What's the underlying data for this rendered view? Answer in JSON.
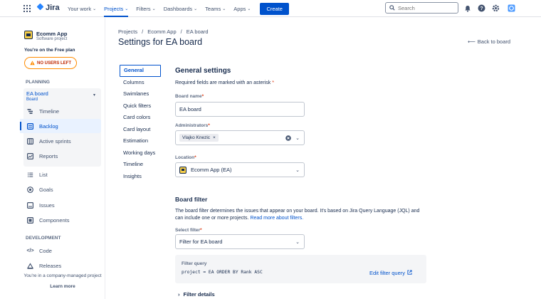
{
  "topbar": {
    "logo": "Jira",
    "nav": [
      {
        "label": "Your work"
      },
      {
        "label": "Projects"
      },
      {
        "label": "Filters"
      },
      {
        "label": "Dashboards"
      },
      {
        "label": "Teams"
      },
      {
        "label": "Apps"
      }
    ],
    "active_nav": "Projects",
    "create_label": "Create",
    "search_placeholder": "Search",
    "icons": [
      "apps-grid-icon",
      "notification-icon",
      "help-icon",
      "settings-icon",
      "profile-icon"
    ]
  },
  "sidebar": {
    "project_name": "Ecomm App",
    "project_type": "Software project",
    "plan_text": "You're on the Free plan",
    "users_badge": "NO USERS LEFT",
    "planning_label": "PLANNING",
    "board_name": "EA board",
    "board_sub": "Board",
    "board_items": [
      {
        "label": "Timeline",
        "icon": "timeline-icon"
      },
      {
        "label": "Backlog",
        "icon": "backlog-icon"
      },
      {
        "label": "Active sprints",
        "icon": "board-icon"
      },
      {
        "label": "Reports",
        "icon": "reports-icon"
      }
    ],
    "selected_item": "Backlog",
    "other_items": [
      {
        "label": "List",
        "icon": "list-icon"
      },
      {
        "label": "Goals",
        "icon": "goals-icon"
      },
      {
        "label": "Issues",
        "icon": "issues-icon"
      },
      {
        "label": "Components",
        "icon": "components-icon"
      }
    ],
    "development_label": "DEVELOPMENT",
    "dev_items": [
      {
        "label": "Code",
        "icon": "code-icon"
      },
      {
        "label": "Releases",
        "icon": "releases-icon"
      }
    ],
    "managed_text": "You're in a company-managed project",
    "learn_more": "Learn more"
  },
  "breadcrumbs": [
    "Projects",
    "/",
    "Ecomm App",
    "/",
    "EA board"
  ],
  "page_title": "Settings for EA board",
  "back_link": "Back to board",
  "settings_nav": [
    "General",
    "Columns",
    "Swimlanes",
    "Quick filters",
    "Card colors",
    "Card layout",
    "Estimation",
    "Working days",
    "Timeline",
    "Insights"
  ],
  "active_settings_nav": "General",
  "general": {
    "heading": "General settings",
    "required_note": "Required fields are marked with an asterisk",
    "board_name_label": "Board name",
    "board_name_value": "EA board",
    "administrators_label": "Administrators",
    "administrator_tag": "Vlajko Knezic",
    "location_label": "Location",
    "location_value": "Ecomm App (EA)"
  },
  "board_filter": {
    "heading": "Board filter",
    "description": "The board filter determines the issues that appear on your board. It's based on Jira Query Language (JQL) and can include one or more projects.",
    "read_more": "Read more about filters.",
    "select_label": "Select filter",
    "select_value": "Filter for EA board",
    "query_label": "Filter query",
    "query_text": "project = EA ORDER BY Rank ASC",
    "edit_link": "Edit filter query",
    "details_label": "Filter details"
  },
  "colors": {
    "accent": "#0052cc",
    "warning": "#ff8b00",
    "required": "#de350b"
  }
}
